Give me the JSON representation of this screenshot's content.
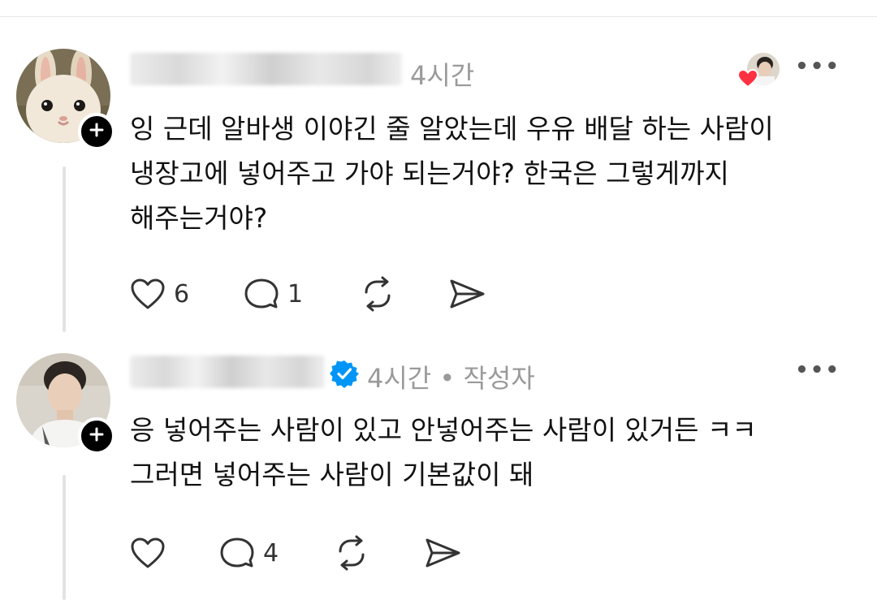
{
  "posts": [
    {
      "time": "4시간",
      "author_tag": "",
      "text_lines": [
        "잉 근데 알바생 이야긴 줄 알았는데 우유 배달 하는 사람이",
        "냉장고에 넣어주고 가야 되는거야? 한국은 그렇게까지",
        "해주는거야?"
      ],
      "likes": "6",
      "replies": "1"
    },
    {
      "time": "4시간 • 작성자",
      "text_lines": [
        "응 넣어주는 사람이 있고 안넣어주는 사람이 있거든 ㅋㅋ",
        "그러면 넣어주는 사람이 기본값이 돼"
      ],
      "likes": "",
      "replies": "4"
    }
  ],
  "icons": [
    "plus-icon",
    "heart-icon",
    "comment-icon",
    "repost-icon",
    "share-icon",
    "more-icon",
    "verified-icon"
  ],
  "colors": {
    "verified": "#0095f6",
    "heart_badge": "#ff3040",
    "meta_text": "#9a9a9a"
  }
}
